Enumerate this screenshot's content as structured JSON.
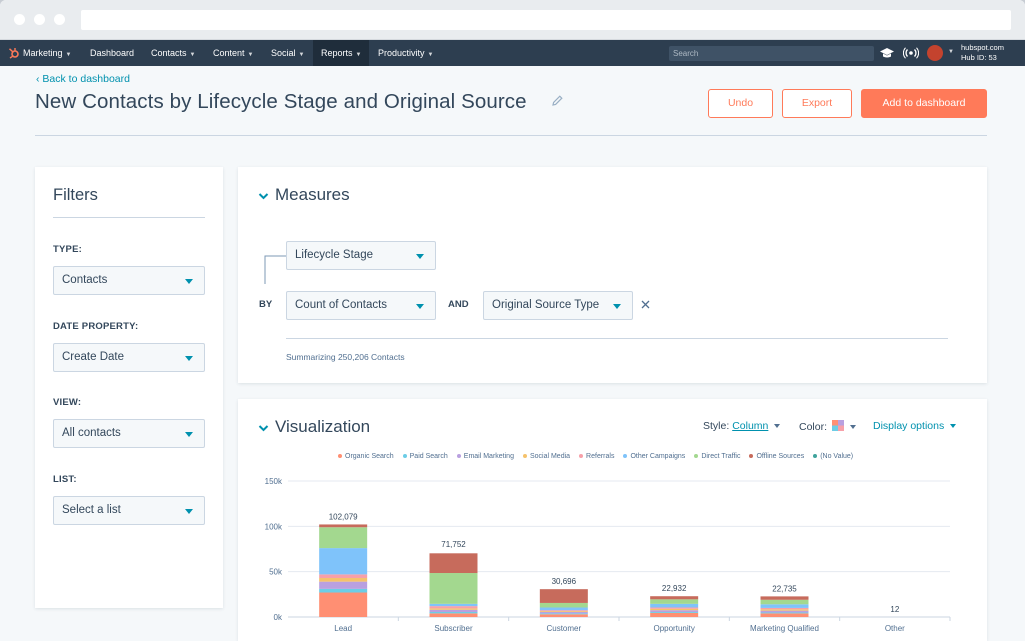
{
  "nav": {
    "items": [
      "Marketing",
      "Dashboard",
      "Contacts",
      "Content",
      "Social",
      "Reports",
      "Productivity"
    ],
    "search_placeholder": "Search",
    "account_name": "hubspot.com",
    "hub_id": "Hub ID: 53"
  },
  "page": {
    "back_link": "Back to dashboard",
    "title": "New Contacts by Lifecycle Stage and Original Source",
    "undo_label": "Undo",
    "export_label": "Export",
    "add_label": "Add to dashboard"
  },
  "filters": {
    "title": "Filters",
    "type_label": "TYPE:",
    "type_value": "Contacts",
    "date_label": "DATE PROPERTY:",
    "date_value": "Create Date",
    "view_label": "VIEW:",
    "view_value": "All contacts",
    "list_label": "LIST:",
    "list_value": "Select a list"
  },
  "measures": {
    "title": "Measures",
    "group_by": "Lifecycle Stage",
    "by_label": "BY",
    "metric": "Count of Contacts",
    "and_label": "AND",
    "breakdown": "Original Source Type",
    "summary": "Summarizing 250,206 Contacts"
  },
  "visualization": {
    "title": "Visualization",
    "style_label": "Style:",
    "style_value": "Column",
    "color_label": "Color:",
    "display_options": "Display options"
  },
  "colors": {
    "accent": "#ff7a59",
    "link": "#0091ae",
    "text": "#33475b"
  },
  "chart_data": {
    "type": "bar",
    "stacked": true,
    "categories": [
      "Lead",
      "Subscriber",
      "Customer",
      "Opportunity",
      "Marketing Qualified",
      "Other"
    ],
    "totals": [
      102079,
      71752,
      30696,
      22932,
      22735,
      12
    ],
    "total_labels": [
      "102,079",
      "71,752",
      "30,696",
      "22,932",
      "22,735",
      "12"
    ],
    "ylim": [
      0,
      150000
    ],
    "yticks": [
      0,
      50000,
      100000,
      150000
    ],
    "ytick_labels": [
      "0k",
      "50k",
      "100k",
      "150k"
    ],
    "legend_position": "top",
    "series": [
      {
        "name": "Organic Search",
        "color": "#ff8f73",
        "values": [
          27000,
          4000,
          3000,
          4500,
          4000,
          0
        ]
      },
      {
        "name": "Paid Search",
        "color": "#6ccde6",
        "values": [
          4000,
          1500,
          1000,
          1000,
          1000,
          0
        ]
      },
      {
        "name": "Email Marketing",
        "color": "#b9a0e0",
        "values": [
          8000,
          2500,
          1500,
          2000,
          2000,
          0
        ]
      },
      {
        "name": "Social Media",
        "color": "#f5c26b",
        "values": [
          4000,
          1500,
          1000,
          1500,
          1500,
          0
        ]
      },
      {
        "name": "Referrals",
        "color": "#f7a0a9",
        "values": [
          4000,
          2500,
          1000,
          1500,
          1500,
          0
        ]
      },
      {
        "name": "Other Campaigns",
        "color": "#7fc3fa",
        "values": [
          29000,
          2500,
          3000,
          4000,
          4000,
          0
        ]
      },
      {
        "name": "Direct Traffic",
        "color": "#a3d88f",
        "values": [
          23000,
          34000,
          5000,
          5000,
          5000,
          0
        ]
      },
      {
        "name": "Offline Sources",
        "color": "#c76b5c",
        "values": [
          3079,
          21752,
          15196,
          3432,
          3735,
          12
        ]
      },
      {
        "name": "(No Value)",
        "color": "#3fa39c",
        "values": [
          0,
          0,
          0,
          0,
          0,
          0
        ]
      }
    ]
  }
}
